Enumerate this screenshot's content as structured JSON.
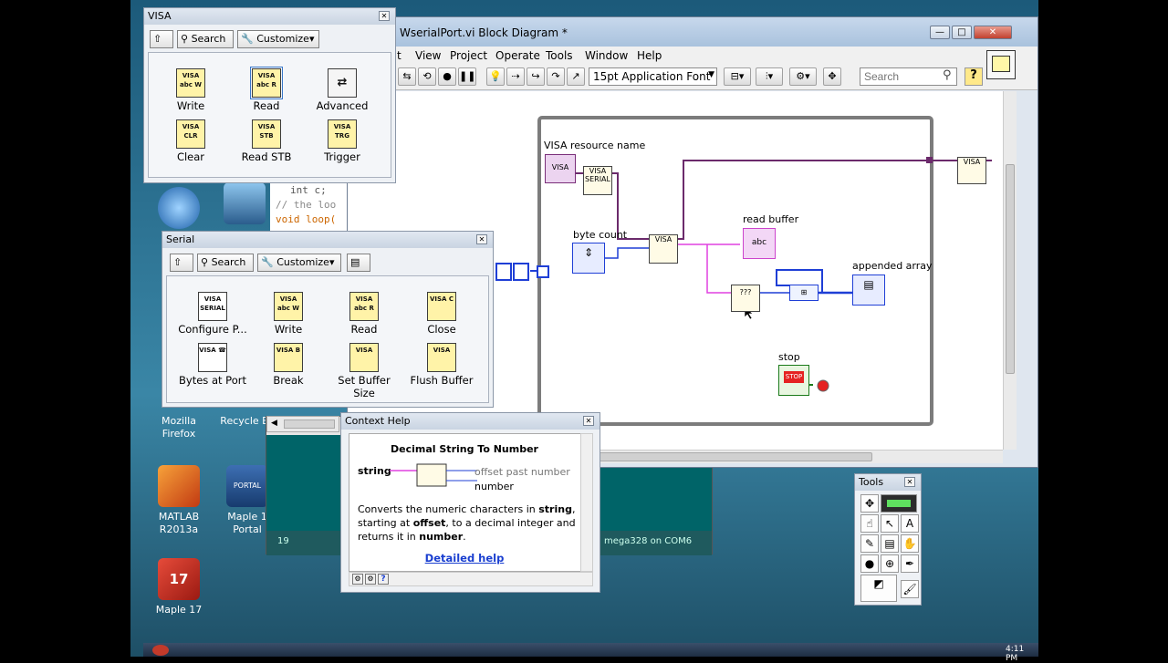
{
  "desktop": {
    "icons": [
      {
        "label": "Mozilla\nFirefox"
      },
      {
        "label": "Recycle B"
      },
      {
        "label": "MATLAB\nR2013a"
      },
      {
        "label": "Maple 1\nPortal"
      },
      {
        "label": "Maple 17"
      }
    ],
    "badges": {
      "portal": "PORTAL",
      "maple17": "17"
    }
  },
  "code_editor": {
    "lines": [
      "int c;",
      "// the loo",
      "void loop("
    ]
  },
  "block_diagram": {
    "title": "WserialPort.vi Block Diagram *",
    "menu": [
      "t",
      "View",
      "Project",
      "Operate",
      "Tools",
      "Window",
      "Help"
    ],
    "font_select": "15pt Application Font",
    "search_placeholder": "Search",
    "help_button": "?",
    "labels": {
      "visa_resource_name": "VISA resource name",
      "byte_count": "byte count",
      "read_buffer": "read buffer",
      "appended_array": "appended array",
      "stop": "stop"
    },
    "node_text": {
      "visa": "VISA",
      "serial": "SERIAL",
      "abc": "abc",
      "stop_btn": "STOP"
    },
    "window_buttons": {
      "min": "—",
      "max": "□",
      "close": "✕"
    }
  },
  "visa_palette": {
    "title": "VISA",
    "search": "Search",
    "customize": "Customize▾",
    "items": [
      {
        "label": "Write",
        "glyph": "VISA abc W"
      },
      {
        "label": "Read",
        "glyph": "VISA abc R"
      },
      {
        "label": "Advanced",
        "glyph": "⇄"
      },
      {
        "label": "Clear",
        "glyph": "VISA CLR"
      },
      {
        "label": "Read STB",
        "glyph": "VISA STB"
      },
      {
        "label": "Trigger",
        "glyph": "VISA TRG"
      }
    ]
  },
  "serial_palette": {
    "title": "Serial",
    "search": "Search",
    "customize": "Customize▾",
    "items": [
      {
        "label": "Configure P...",
        "glyph": "VISA SERIAL"
      },
      {
        "label": "Write",
        "glyph": "VISA abc W"
      },
      {
        "label": "Read",
        "glyph": "VISA abc R"
      },
      {
        "label": "Close",
        "glyph": "VISA C"
      },
      {
        "label": "Bytes at Port",
        "glyph": "VISA ☎"
      },
      {
        "label": "Break",
        "glyph": "VISA B"
      },
      {
        "label": "Set Buffer Size",
        "glyph": "VISA"
      },
      {
        "label": "Flush Buffer",
        "glyph": "VISA"
      }
    ]
  },
  "context_help": {
    "title": "Context Help",
    "heading": "Decimal String To Number",
    "in_label": "string",
    "out_label_1": "offset past number",
    "out_label_2": "number",
    "desc_1": "Converts the numeric characters in ",
    "desc_1b": "string",
    "desc_1c": ",",
    "desc_2": "starting at ",
    "desc_2b": "offset",
    "desc_2c": ", to a decimal integer and",
    "desc_3": "returns it in ",
    "desc_3b": "number",
    "desc_3c": ".",
    "link": "Detailed help"
  },
  "tools_palette": {
    "title": "Tools"
  },
  "ide": {
    "status_left": "19",
    "status_right": "mega328 on COM6"
  },
  "taskbar": {
    "clock": "4:11 PM"
  },
  "colors": {
    "wire_pink": "#e040e0",
    "wire_blue": "#1f3fd6",
    "wire_dark": "#6b2a6b",
    "loop_border": "#7c7c7c"
  }
}
